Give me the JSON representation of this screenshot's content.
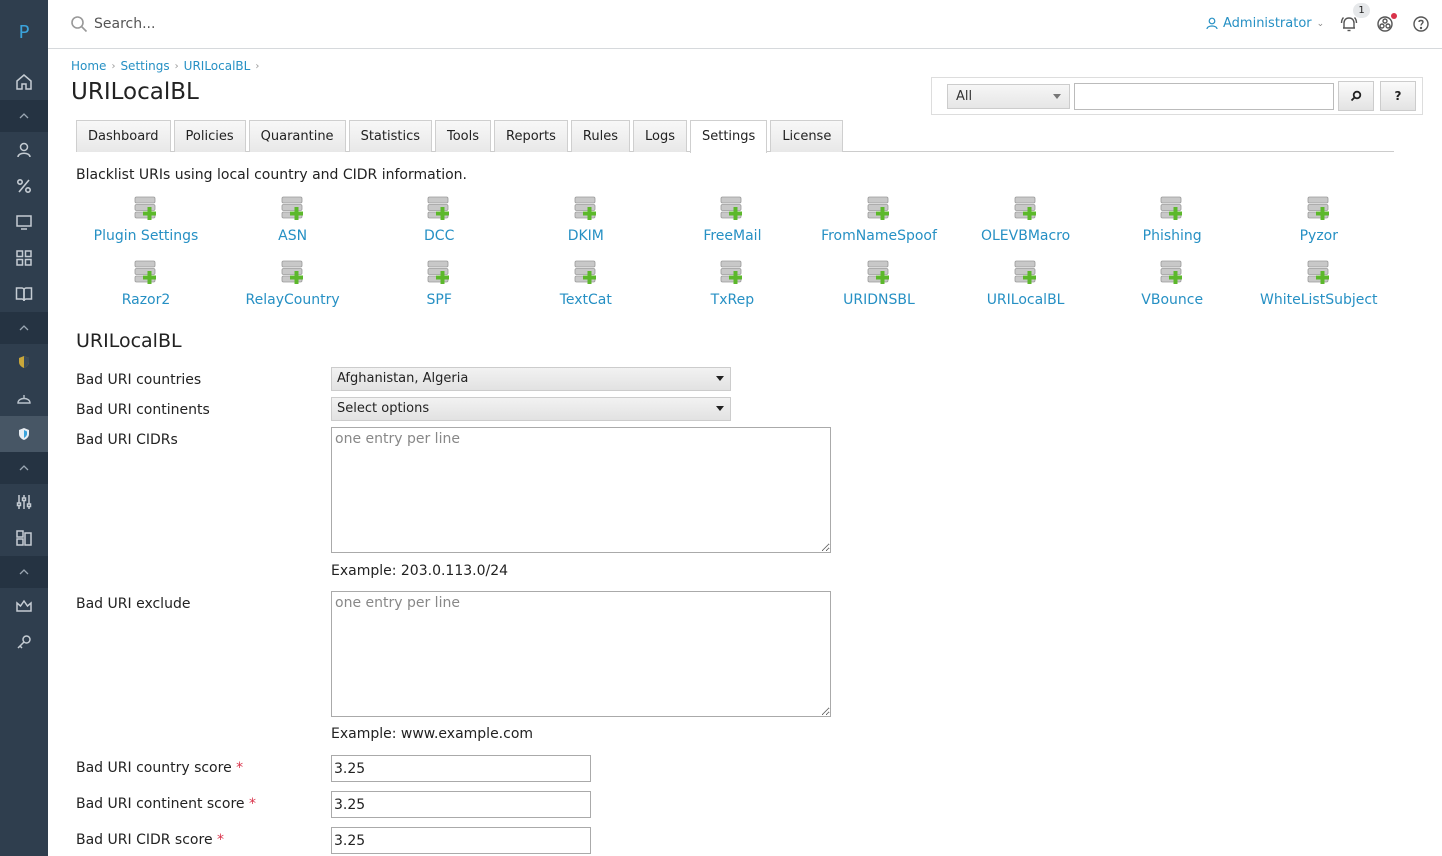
{
  "sidebar": {
    "logo": "P",
    "items": [
      {
        "icon": "home-icon"
      },
      {
        "icon": "user-icon"
      },
      {
        "icon": "percent-icon"
      },
      {
        "icon": "monitor-icon"
      },
      {
        "icon": "grid-icon"
      },
      {
        "icon": "book-icon"
      },
      {
        "icon": "shield-bolt-icon"
      },
      {
        "icon": "dome-icon"
      },
      {
        "icon": "shield-check-icon"
      },
      {
        "icon": "sliders-icon"
      },
      {
        "icon": "blocks-icon"
      },
      {
        "icon": "crown-icon"
      },
      {
        "icon": "key-icon"
      }
    ]
  },
  "topbar": {
    "search_placeholder": "Search...",
    "user_label": "Administrator",
    "notification_count": "1"
  },
  "breadcrumb": [
    "Home",
    "Settings",
    "URILocalBL"
  ],
  "page_title": "URILocalBL",
  "filter": {
    "select_value": "All",
    "search_button": "⌕",
    "help_button": "?"
  },
  "tabs": [
    "Dashboard",
    "Policies",
    "Quarantine",
    "Statistics",
    "Tools",
    "Reports",
    "Rules",
    "Logs",
    "Settings",
    "License"
  ],
  "active_tab": "Settings",
  "description": "Blacklist URIs using local country and CIDR information.",
  "plugins_row1": [
    "Plugin Settings",
    "ASN",
    "DCC",
    "DKIM",
    "FreeMail",
    "FromNameSpoof",
    "OLEVBMacro",
    "Phishing",
    "Pyzor"
  ],
  "plugins_row2": [
    "Razor2",
    "RelayCountry",
    "SPF",
    "TextCat",
    "TxRep",
    "URIDNSBL",
    "URILocalBL",
    "VBounce",
    "WhiteListSubject"
  ],
  "section_title": "URILocalBL",
  "form": {
    "countries_label": "Bad URI countries",
    "countries_value": "Afghanistan, Algeria",
    "continents_label": "Bad URI continents",
    "continents_value": "Select options",
    "cidrs_label": "Bad URI CIDRs",
    "cidrs_placeholder": "one entry per line",
    "cidrs_hint": "Example: 203.0.113.0/24",
    "exclude_label": "Bad URI exclude",
    "exclude_placeholder": "one entry per line",
    "exclude_hint": "Example: www.example.com",
    "country_score_label": "Bad URI country score",
    "country_score_value": "3.25",
    "continent_score_label": "Bad URI continent score",
    "continent_score_value": "3.25",
    "cidr_score_label": "Bad URI CIDR score",
    "cidr_score_value": "3.25",
    "required_mark": "*"
  },
  "colors": {
    "sidebar_bg": "#2f3e4e",
    "link": "#2690c4",
    "required": "#d9324a"
  }
}
